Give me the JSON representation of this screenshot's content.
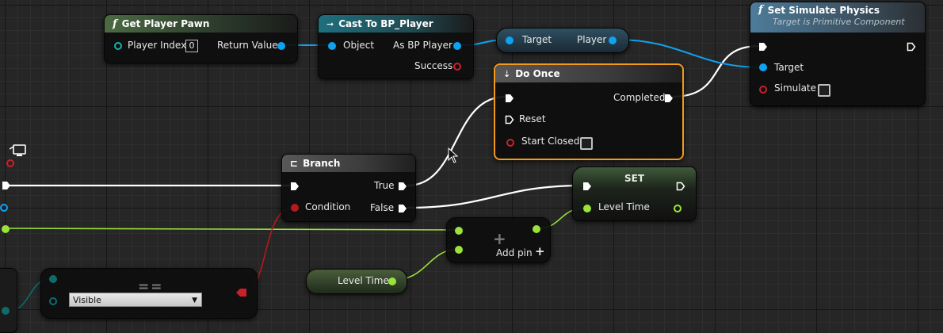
{
  "nodes": {
    "get_player_pawn": {
      "title": "Get Player Pawn",
      "player_index_label": "Player Index",
      "player_index_value": "0",
      "return_value_label": "Return Value"
    },
    "cast_to_bp_player": {
      "title": "Cast To BP_Player",
      "object_label": "Object",
      "as_bp_player_label": "As BP Player",
      "success_label": "Success"
    },
    "target_player_getter": {
      "target_label": "Target",
      "player_label": "Player"
    },
    "set_simulate_physics": {
      "title": "Set Simulate Physics",
      "subtitle": "Target is Primitive Component",
      "target_label": "Target",
      "simulate_label": "Simulate"
    },
    "do_once": {
      "title": "Do Once",
      "completed_label": "Completed",
      "reset_label": "Reset",
      "start_closed_label": "Start Closed"
    },
    "branch": {
      "title": "Branch",
      "condition_label": "Condition",
      "true_label": "True",
      "false_label": "False"
    },
    "set_level_time": {
      "title": "SET",
      "level_time_label": "Level Time"
    },
    "add_node": {
      "symbol": "+",
      "add_pin_label": "Add pin",
      "add_pin_icon": "+"
    },
    "level_time_getter": {
      "label": "Level Time"
    },
    "equal_enum": {
      "symbol": "==",
      "dropdown_value": "Visible"
    }
  },
  "icons": [
    "function-icon",
    "cast-icon",
    "do-once-icon",
    "branch-icon",
    "monitor-icon",
    "mouse-cursor-icon",
    "dropdown-arrow-icon"
  ],
  "colors": {
    "selection_outline": "#f39a1c",
    "exec_wire": "#ffffff",
    "object_wire": "#0fa2f0",
    "float_wire": "#9be33a",
    "bool_wire": "#b5191f",
    "enum_wire": "#0f6b6b"
  }
}
